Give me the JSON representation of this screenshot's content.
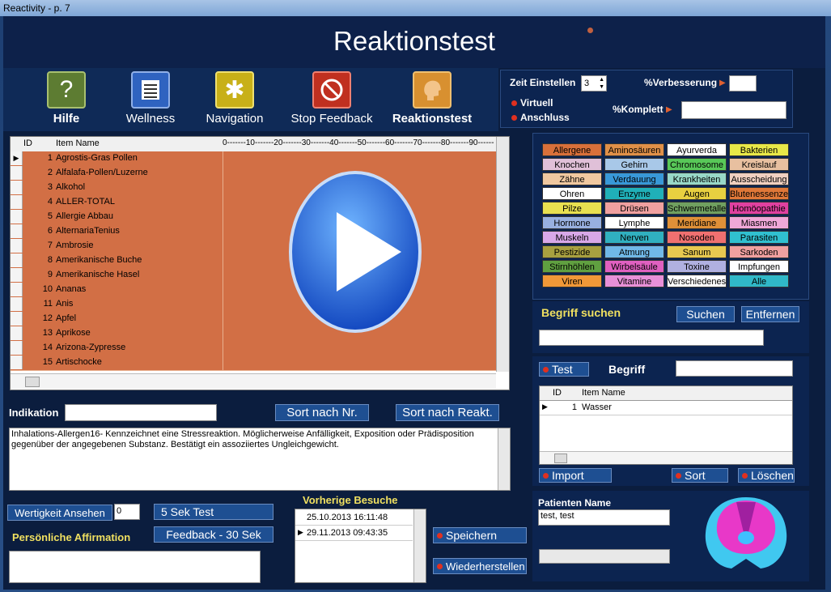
{
  "window_title": "Reactivity - p. 7",
  "header_title": "Reaktionstest",
  "nav": [
    {
      "label": "Hilfe",
      "icon": "question-icon",
      "color": "#6b8a3a"
    },
    {
      "label": "Wellness",
      "icon": "document-icon",
      "color": "#2f63c0"
    },
    {
      "label": "Navigation",
      "icon": "asterisk-icon",
      "color": "#c8b018"
    },
    {
      "label": "Stop Feedback",
      "icon": "stop-icon",
      "color": "#c03020"
    },
    {
      "label": "Reaktionstest",
      "icon": "head-icon",
      "color": "#d89030"
    }
  ],
  "settings": {
    "zeit_label": "Zeit Einstellen",
    "zeit_value": "3",
    "verbesserung_label": "%Verbesserung",
    "virtuell_label": "Virtuell",
    "anschluss_label": "Anschluss",
    "komplett_label": "%Komplett"
  },
  "main_table": {
    "col_id": "ID",
    "col_name": "Item Name",
    "scale": "0-------10-------20-------30-------40-------50-------60-------70-------80-------90-------10",
    "rows": [
      {
        "id": "1",
        "name": "Agrostis-Gras Pollen"
      },
      {
        "id": "2",
        "name": "Alfalafa-Pollen/Luzerne"
      },
      {
        "id": "3",
        "name": "Alkohol"
      },
      {
        "id": "4",
        "name": "ALLER-TOTAL"
      },
      {
        "id": "5",
        "name": "Allergie Abbau"
      },
      {
        "id": "6",
        "name": "AlternariaTenius"
      },
      {
        "id": "7",
        "name": "Ambrosie"
      },
      {
        "id": "8",
        "name": "Amerikanische Buche"
      },
      {
        "id": "9",
        "name": "Amerikanische Hasel"
      },
      {
        "id": "10",
        "name": "Ananas"
      },
      {
        "id": "11",
        "name": "Anis"
      },
      {
        "id": "12",
        "name": "Apfel"
      },
      {
        "id": "13",
        "name": "Aprikose"
      },
      {
        "id": "14",
        "name": "Arizona-Zypresse"
      },
      {
        "id": "15",
        "name": "Artischocke"
      }
    ]
  },
  "categories": [
    {
      "label": "Allergene",
      "color": "#d8703a"
    },
    {
      "label": "Aminosäuren",
      "color": "#e09048"
    },
    {
      "label": "Ayurverda",
      "color": "#ffffff"
    },
    {
      "label": "Bakterien",
      "color": "#e8e848"
    },
    {
      "label": "Knochen",
      "color": "#e0c0d8"
    },
    {
      "label": "Gehirn",
      "color": "#a8c8e8"
    },
    {
      "label": "Chromosome",
      "color": "#58c858"
    },
    {
      "label": "Kreislauf",
      "color": "#e8c0a0"
    },
    {
      "label": "Zähne",
      "color": "#f0c8a0"
    },
    {
      "label": "Verdauung",
      "color": "#3898d8"
    },
    {
      "label": "Krankheiten",
      "color": "#98d8c8"
    },
    {
      "label": "Ausscheidung",
      "color": "#f0d0c0"
    },
    {
      "label": "Ohren",
      "color": "#ffffff"
    },
    {
      "label": "Enzyme",
      "color": "#20b0b8"
    },
    {
      "label": "Augen",
      "color": "#e8d040"
    },
    {
      "label": "Blutenessenze",
      "color": "#e07838"
    },
    {
      "label": "Pilze",
      "color": "#e8e050"
    },
    {
      "label": "Drüsen",
      "color": "#f0a0a0"
    },
    {
      "label": "Schwermetalle",
      "color": "#70a060"
    },
    {
      "label": "Homöopathie",
      "color": "#e040a0"
    },
    {
      "label": "Hormone",
      "color": "#98b0e0"
    },
    {
      "label": "Lymphe",
      "color": "#ffffff"
    },
    {
      "label": "Meridiane",
      "color": "#e09038"
    },
    {
      "label": "Miasmen",
      "color": "#f0a8d8"
    },
    {
      "label": "Muskeln",
      "color": "#d8a8e8"
    },
    {
      "label": "Nerven",
      "color": "#30b0c0"
    },
    {
      "label": "Nosoden",
      "color": "#f07070"
    },
    {
      "label": "Parasiten",
      "color": "#30c0d0"
    },
    {
      "label": "Pestizide",
      "color": "#a8a040"
    },
    {
      "label": "Atmung",
      "color": "#70b8e8"
    },
    {
      "label": "Sanum",
      "color": "#e8c850"
    },
    {
      "label": "Sarkoden",
      "color": "#f0a0a0"
    },
    {
      "label": "Stirnhöhlen",
      "color": "#60a040"
    },
    {
      "label": "Wirbelsäule",
      "color": "#e060c0"
    },
    {
      "label": "Toxine",
      "color": "#b0b0e0"
    },
    {
      "label": "Impfungen",
      "color": "#ffffff"
    },
    {
      "label": "Viren",
      "color": "#f09838"
    },
    {
      "label": "Vitamine",
      "color": "#e890d8"
    },
    {
      "label": "Verschiedenes",
      "color": "#ffffff"
    },
    {
      "label": "Alle",
      "color": "#30b8c8"
    }
  ],
  "search": {
    "label": "Begriff suchen",
    "search_btn": "Suchen",
    "remove_btn": "Entfernen"
  },
  "test": {
    "test_btn": "Test",
    "begriff_label": "Begriff",
    "col_id": "ID",
    "col_name": "Item Name",
    "rows": [
      {
        "id": "1",
        "name": "Wasser"
      }
    ],
    "import_btn": "Import",
    "sort_btn": "Sort",
    "delete_btn": "Löschen"
  },
  "indikation": {
    "label": "Indikation",
    "sort_nr": "Sort nach Nr.",
    "sort_reakt": "Sort nach Reakt.",
    "description": "Inhalations-Allergen16- Kennzeichnet eine Stressreaktion. Möglicherweise Anfälligkeit, Exposition oder Prädisposition gegenüber der angegebenen Substanz. Bestätigt ein assoziiertes Ungleichgewicht."
  },
  "bottom": {
    "wertigkeit_btn": "Wertigkeit Ansehen",
    "wertigkeit_value": "0",
    "test5": "5 Sek Test",
    "feedback30": "Feedback - 30 Sek",
    "affirmation_label": "Persönliche Affirmation",
    "visits_label": "Vorherige Besuche",
    "visits": [
      {
        "date": "25.10.2013 16:11:48"
      },
      {
        "date": "29.11.2013 09:43:35"
      }
    ],
    "save_btn": "Speichern",
    "restore_btn": "Wiederherstellen"
  },
  "patient": {
    "label": "Patienten Name",
    "name": "test, test"
  }
}
